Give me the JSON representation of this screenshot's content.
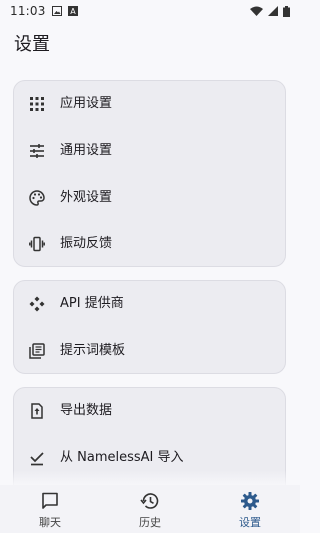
{
  "status_bar": {
    "time": "11:03"
  },
  "page": {
    "title": "设置"
  },
  "groups": [
    {
      "items": [
        {
          "label": "应用设置",
          "icon": "apps-grid-icon"
        },
        {
          "label": "通用设置",
          "icon": "tune-sliders-icon"
        },
        {
          "label": "外观设置",
          "icon": "palette-icon"
        },
        {
          "label": "振动反馈",
          "icon": "vibration-icon"
        }
      ]
    },
    {
      "items": [
        {
          "label": "API 提供商",
          "icon": "hub-diamond-icon"
        },
        {
          "label": "提示词模板",
          "icon": "library-books-icon"
        }
      ]
    },
    {
      "items": [
        {
          "label": "导出数据",
          "icon": "file-upload-icon"
        },
        {
          "label": "从 NamelessAI 导入",
          "icon": "download-done-icon"
        }
      ]
    }
  ],
  "bottom_nav": [
    {
      "label": "聊天",
      "icon": "chat-icon"
    },
    {
      "label": "历史",
      "icon": "history-icon"
    },
    {
      "label": "设置",
      "icon": "gear-icon",
      "active": true
    }
  ],
  "colors": {
    "accent": "#2d5a8c",
    "card": "#ececf1",
    "background": "#f8f8fb"
  }
}
